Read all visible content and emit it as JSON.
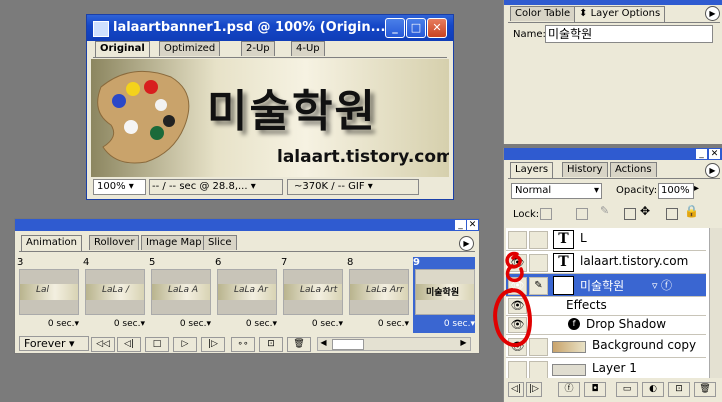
{
  "image_window": {
    "title": "lalaartbanner1.psd @ 100% (Origin...",
    "tabs": [
      "Original",
      "Optimized",
      "2-Up",
      "4-Up"
    ],
    "banner_korean": "미술학원",
    "banner_url": "lalaart.tistory.com",
    "status": {
      "zoom": "100%",
      "speed": "-- / -- sec @ 28.8,...",
      "size": "~370K / -- GIF"
    }
  },
  "animation_panel": {
    "tabs": [
      "Animation",
      "Rollover",
      "Image Map",
      "Slice"
    ],
    "frames": [
      {
        "num": "3",
        "thumb_text": "Lal",
        "delay": "0 sec."
      },
      {
        "num": "4",
        "thumb_text": "LaLa /",
        "delay": "0 sec."
      },
      {
        "num": "5",
        "thumb_text": "LaLa A",
        "delay": "0 sec."
      },
      {
        "num": "6",
        "thumb_text": "LaLa Ar",
        "delay": "0 sec."
      },
      {
        "num": "7",
        "thumb_text": "LaLa Art",
        "delay": "0 sec."
      },
      {
        "num": "8",
        "thumb_text": "LaLa Arr",
        "delay": "0 sec."
      },
      {
        "num": "9",
        "thumb_text": "미술학원",
        "delay": "0 sec."
      }
    ],
    "loop": "Forever",
    "toolbar": [
      "◁◁",
      "◁|",
      "□",
      "▷",
      "|▷",
      "∘∘",
      "⊡",
      "🗑"
    ]
  },
  "layer_options": {
    "tabs": [
      "Color Table",
      "Layer Options"
    ],
    "name_label": "Name:",
    "name_value": "미술학원"
  },
  "layers_panel": {
    "tabs": [
      "Layers",
      "History",
      "Actions"
    ],
    "blend_mode": "Normal",
    "opacity_label": "Opacity:",
    "opacity_value": "100%",
    "lock_label": "Lock:",
    "layers": [
      {
        "name": "L",
        "type": "text",
        "visible": false
      },
      {
        "name": "lalaart.tistory.com",
        "type": "text",
        "visible": true
      },
      {
        "name": "미술학원",
        "type": "text",
        "visible": true,
        "selected": true
      },
      {
        "name": "Effects",
        "type": "effects"
      },
      {
        "name": "Drop Shadow",
        "type": "effect"
      },
      {
        "name": "Background copy",
        "type": "image",
        "visible": true
      },
      {
        "name": "Layer 1",
        "type": "image",
        "visible": false
      }
    ]
  },
  "colors": {
    "titlebar": "#1547c7",
    "panel_bg": "#ece9d8",
    "desktop": "#7b7b7b",
    "annotation": "#e00000"
  }
}
